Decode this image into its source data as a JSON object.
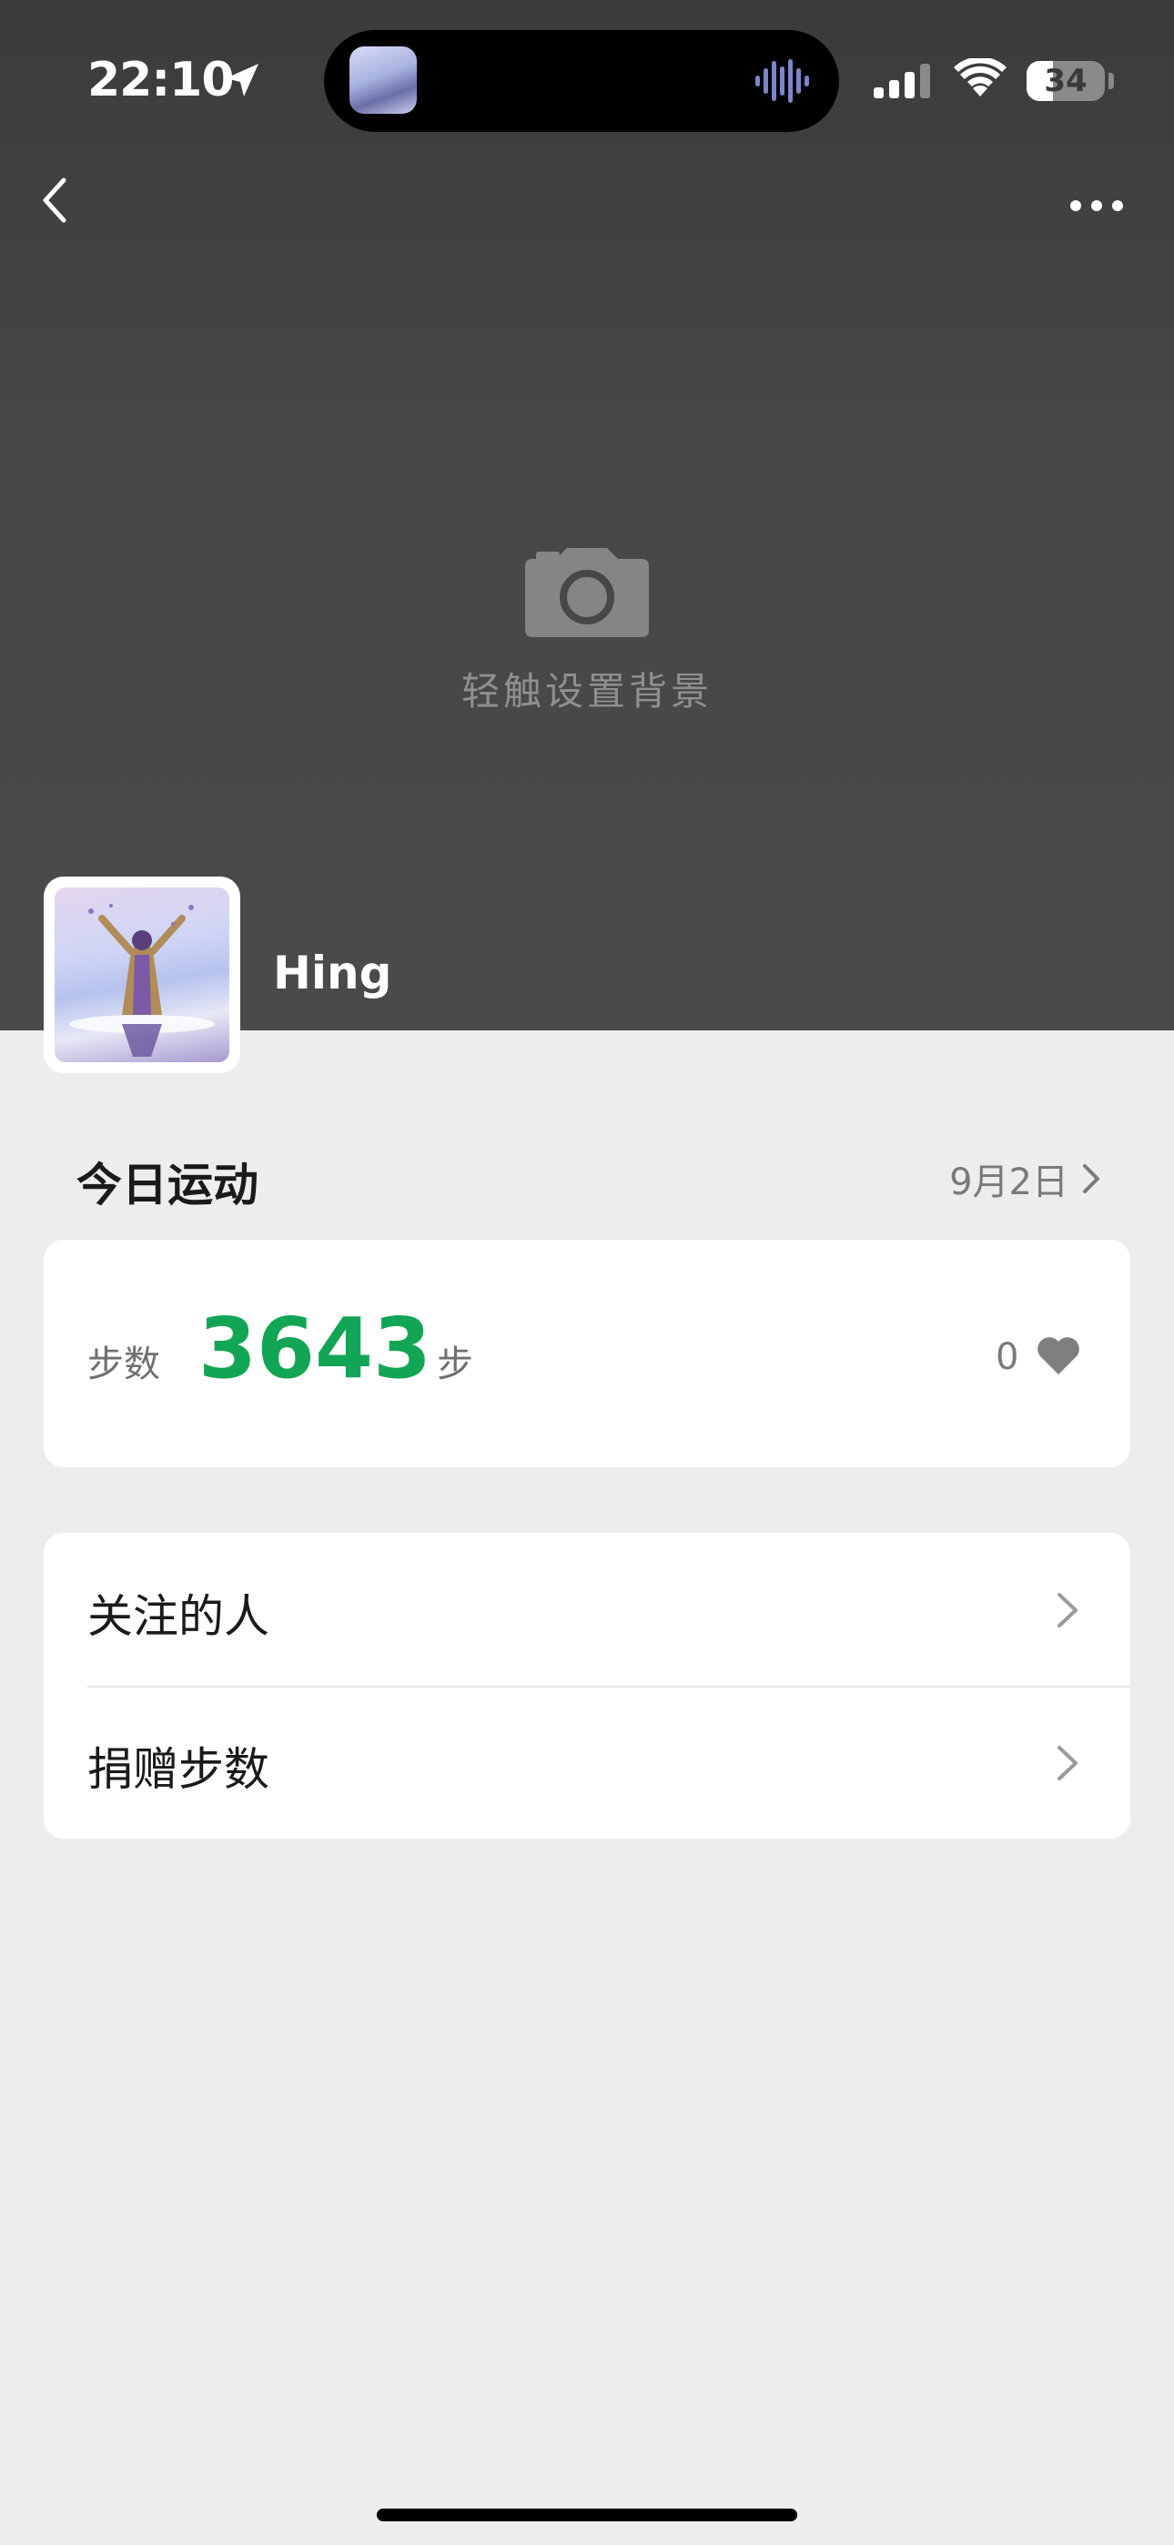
{
  "status_bar": {
    "time": "22:10",
    "battery": "34",
    "battery_level": 0.34
  },
  "header": {
    "background_prompt": "轻触设置背景",
    "username": "Hing"
  },
  "today": {
    "title": "今日运动",
    "date": "9月2日"
  },
  "steps": {
    "label": "步数",
    "value": "3643",
    "unit": "步",
    "likes": "0"
  },
  "menu": {
    "items": [
      {
        "label": "关注的人"
      },
      {
        "label": "捐赠步数"
      }
    ]
  },
  "colors": {
    "accent_green": "#13a556"
  },
  "icons": [
    "location-arrow-icon",
    "waveform-icon",
    "signal-icon",
    "wifi-icon",
    "back-chevron-icon",
    "more-dots-icon",
    "camera-icon",
    "chevron-right-icon",
    "heart-icon"
  ]
}
